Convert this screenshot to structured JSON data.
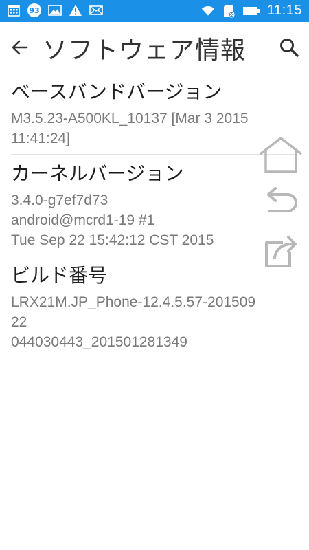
{
  "status_bar": {
    "notification_count": "93",
    "time": "11:15"
  },
  "app_bar": {
    "title": "ソフトウェア情報"
  },
  "items": [
    {
      "title": "ベースバンドバージョン",
      "lines": [
        "M3.5.23-A500KL_10137 [Mar  3 2015",
        "11:41:24]"
      ]
    },
    {
      "title": "カーネルバージョン",
      "lines": [
        "3.4.0-g7ef7d73",
        "android@mcrd1-19 #1",
        "Tue Sep 22 15:42:12 CST 2015"
      ]
    },
    {
      "title": "ビルド番号",
      "lines": [
        "LRX21M.JP_Phone-12.4.5.57-201509",
        "22",
        "044030443_201501281349"
      ]
    }
  ],
  "icons": {
    "status_left": [
      "calendar-icon",
      "notification-count-badge",
      "image-icon",
      "warning-icon",
      "mail-icon"
    ],
    "status_right": [
      "wifi-icon",
      "sd-card-icon",
      "battery-icon"
    ],
    "float": [
      "home-icon",
      "back-icon",
      "share-icon"
    ]
  },
  "colors": {
    "status_bar": "#1a90e6",
    "title_text": "#333333",
    "item_title": "#1e1e1e",
    "item_text": "#7a7a7a",
    "divider": "#e3e3e3",
    "float_icon": "#b8b8b8"
  }
}
